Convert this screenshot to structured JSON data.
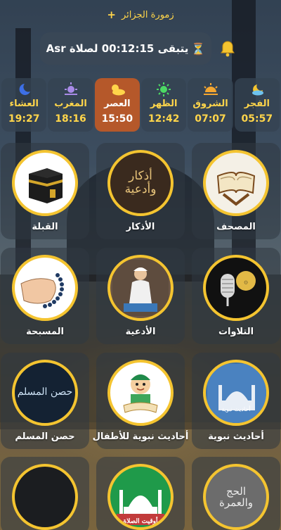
{
  "header": {
    "title": "زمورة الجزائر",
    "add_label": "+"
  },
  "countdown": {
    "text": "يتبقى 00:12:15 لصلاة Asr"
  },
  "prayers": [
    {
      "name": "الفجر",
      "time": "05:57",
      "icon": "moon-cloud-icon",
      "active": false
    },
    {
      "name": "الشروق",
      "time": "07:07",
      "icon": "sunrise-icon",
      "active": false
    },
    {
      "name": "الظهر",
      "time": "12:42",
      "icon": "sun-icon",
      "active": false
    },
    {
      "name": "العصر",
      "time": "15:50",
      "icon": "sun-cloud-icon",
      "active": true
    },
    {
      "name": "المغرب",
      "time": "18:16",
      "icon": "sunset-icon",
      "active": false
    },
    {
      "name": "العشاء",
      "time": "19:27",
      "icon": "moon-icon",
      "active": false
    }
  ],
  "features": [
    {
      "label": "المصحف",
      "icon": "quran-icon"
    },
    {
      "label": "الأذكار",
      "icon": "adhkar-icon",
      "inner": [
        "أذكار",
        "وأدعية"
      ]
    },
    {
      "label": "القبلة",
      "icon": "kaaba-icon"
    },
    {
      "label": "التلاوات",
      "icon": "microphone-icon"
    },
    {
      "label": "الأدعية",
      "icon": "praying-man-icon"
    },
    {
      "label": "المسبحة",
      "icon": "tasbih-icon"
    },
    {
      "label": "أحاديث نبوية",
      "icon": "hadith-icon",
      "inner": [
        "أحاديث نبوية"
      ]
    },
    {
      "label": "أحاديث نبوية للأطفال",
      "icon": "kids-reading-icon"
    },
    {
      "label": "حصن المسلم",
      "icon": "hisn-icon",
      "inner": [
        "حصن المسلم"
      ]
    },
    {
      "label": "",
      "icon": "hajj-icon",
      "inner": [
        "الحج",
        "والعمرة"
      ]
    },
    {
      "label": "",
      "icon": "prayer-times-icon",
      "inner": [
        "أوقيت الصلاة"
      ]
    },
    {
      "label": "",
      "icon": "blank-icon"
    }
  ],
  "colors": {
    "accent": "#f4c430",
    "active_prayer": "#b5582a",
    "gold_text": "#ffd54a"
  }
}
